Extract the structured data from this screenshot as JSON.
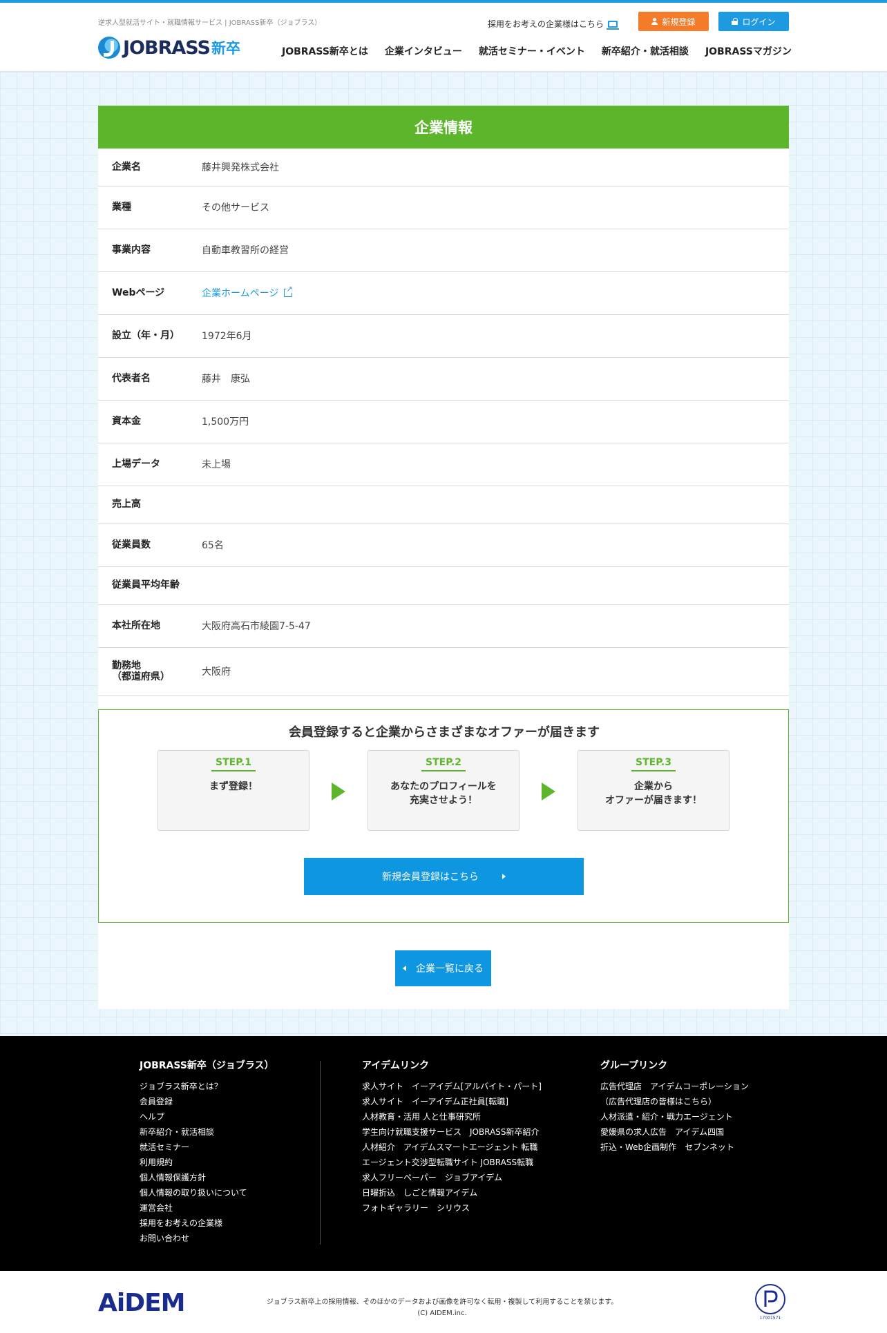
{
  "header": {
    "tagline": "逆求人型就活サイト・就職情報サービス | JOBRASS新卒（ジョブラス）",
    "logo_text": "JOBRASS",
    "logo_sub": "新卒",
    "corp_link": "採用をお考えの企業様はこちら",
    "register_label": "新規登録",
    "login_label": "ログイン",
    "nav": [
      "JOBRASS新卒とは",
      "企業インタビュー",
      "就活セミナー・イベント",
      "新卒紹介・就活相談",
      "JOBRASSマガジン"
    ]
  },
  "company": {
    "section_title": "企業情報",
    "rows": [
      {
        "label": "企業名",
        "value": "藤井興発株式会社"
      },
      {
        "label": "業種",
        "value": "その他サービス"
      },
      {
        "label": "事業内容",
        "value": "自動車教習所の経営"
      },
      {
        "label": "Webページ",
        "value": "企業ホームページ"
      },
      {
        "label": "設立（年・月）",
        "value": "1972年6月"
      },
      {
        "label": "代表者名",
        "value": "藤井　康弘"
      },
      {
        "label": "資本金",
        "value": "1,500万円"
      },
      {
        "label": "上場データ",
        "value": "未上場"
      },
      {
        "label": "売上高",
        "value": ""
      },
      {
        "label": "従業員数",
        "value": "65名"
      },
      {
        "label": "従業員平均年齢",
        "value": ""
      },
      {
        "label": "本社所在地",
        "value": "大阪府高石市綾園7-5-47"
      },
      {
        "label": "勤務地",
        "label2": "（都道府県）",
        "value": "大阪府"
      }
    ]
  },
  "offer": {
    "title": "会員登録すると企業からさまざまなオファーが届きます",
    "steps": [
      {
        "label": "STEP.1",
        "line1": "まず登録！",
        "line2": ""
      },
      {
        "label": "STEP.2",
        "line1": "あなたのプロフィールを",
        "line2": "充実させよう！"
      },
      {
        "label": "STEP.3",
        "line1": "企業から",
        "line2": "オファーが届きます！"
      }
    ],
    "signup_label": "新規会員登録はこちら"
  },
  "back_label": "企業一覧に戻る",
  "footer": {
    "col1": {
      "title": "JOBRASS新卒（ジョブラス）",
      "links": [
        "ジョブラス新卒とは？",
        "会員登録",
        "ヘルプ",
        "新卒紹介・就活相談",
        "就活セミナー",
        "利用規約",
        "個人情報保護方針",
        "個人情報の取り扱いについて",
        "運営会社",
        "採用をお考えの企業様",
        "お問い合わせ"
      ]
    },
    "col2": {
      "title": "アイデムリンク",
      "links": [
        "求人サイト　イーアイデム[アルバイト・パート]",
        "求人サイト　イーアイデム正社員[転職]",
        "人材教育・活用 人と仕事研究所",
        "学生向け就職支援サービス　JOBRASS新卒紹介",
        "人材紹介　アイデムスマートエージェント 転職",
        "エージェント交渉型転職サイト JOBRASS転職",
        "求人フリーペーパー　ジョブアイデム",
        "日曜折込　しごと情報アイデム",
        "フォトギャラリー　シリウス"
      ]
    },
    "col3": {
      "title": "グループリンク",
      "links": [
        "広告代理店　アイデムコーポレーション",
        "（広告代理店の皆様はこちら）",
        "人材派遣・紹介・戦力エージェント",
        "愛媛県の求人広告　アイデム四国",
        "折込・Web企画制作　セブンネット"
      ]
    }
  },
  "bottom": {
    "logo": "AiDEM",
    "note": "ジョブラス新卒上の採用情報、そのほかのデータおよび画像を許可なく転用・複製して利用することを禁じます。",
    "copyright": "(C) AIDEM.inc.",
    "pmark_number": "17001571"
  },
  "colors": {
    "brand_blue": "#1e9be0",
    "brand_green": "#5cb52a",
    "register_orange": "#f47b2a"
  }
}
